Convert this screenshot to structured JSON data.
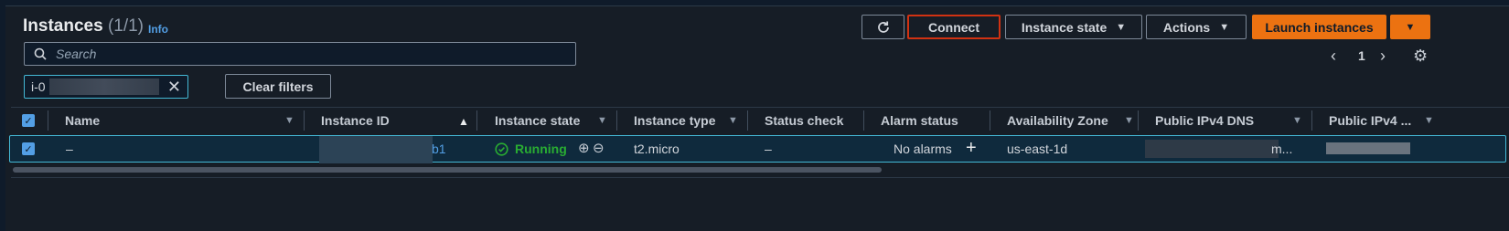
{
  "header": {
    "title": "Instances",
    "count": "(1/1)",
    "info_link": "Info"
  },
  "toolbar": {
    "refresh_icon": "refresh-icon",
    "connect_label": "Connect",
    "instance_state_label": "Instance state",
    "actions_label": "Actions",
    "launch_label": "Launch instances",
    "caret": "▼"
  },
  "search": {
    "placeholder": "Search"
  },
  "filter_token": {
    "text": "i-0",
    "clear_label": "Clear filters"
  },
  "pagination": {
    "prev": "‹",
    "page": "1",
    "next": "›"
  },
  "table": {
    "columns": [
      "Name",
      "Instance ID",
      "Instance state",
      "Instance type",
      "Status check",
      "Alarm status",
      "Availability Zone",
      "Public IPv4 DNS",
      "Public IPv4 ..."
    ],
    "rows": [
      {
        "name": "–",
        "instance_id_suffix": "b1",
        "state": "Running",
        "type": "t2.micro",
        "status_check": "–",
        "alarm_status": "No alarms",
        "zone": "us-east-1d",
        "dns_suffix": "m..."
      }
    ]
  },
  "colors": {
    "background": "#161d26",
    "accent_orange": "#ec7211",
    "link_blue": "#539fe5",
    "selection_border": "#44b9d6",
    "running_green": "#29ad32",
    "highlight_red": "#d13212"
  }
}
